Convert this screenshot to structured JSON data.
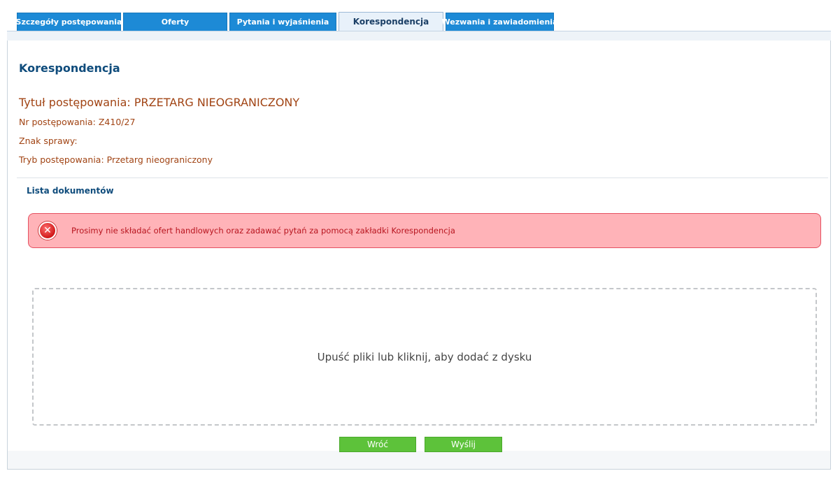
{
  "tabs": [
    {
      "label": "Szczegóły postępowania",
      "active": false
    },
    {
      "label": "Oferty",
      "active": false
    },
    {
      "label": "Pytania i wyjaśnienia",
      "active": false
    },
    {
      "label": "Korespondencja",
      "active": true
    },
    {
      "label": "Wezwania i zawiadomienia",
      "active": false
    }
  ],
  "page": {
    "section_title": "Korespondencja",
    "procedure_title": "Tytuł postępowania: PRZETARG NIEOGRANICZONY",
    "procedure_number": "Nr postępowania: Z410/27",
    "case_sign": "Znak sprawy:",
    "procedure_mode": "Tryb postępowania: Przetarg nieograniczony",
    "document_list_label": "Lista dokumentów"
  },
  "alert": {
    "icon": "error-x-icon",
    "message": "Prosimy nie składać ofert handlowych oraz zadawać pytań za pomocą zakładki Korespondencja",
    "color_bg": "#ffb3b8",
    "color_border": "#e55060",
    "color_text": "#b8141e"
  },
  "dropzone": {
    "text": "Upuść pliki lub kliknij, aby dodać z dysku"
  },
  "buttons": {
    "back_label": "Wróć",
    "send_label": "Wyślij"
  },
  "colors": {
    "tab_bg": "#1d8ad6",
    "tab_active_bg": "#e8f1fa",
    "heading": "#0f4c7c",
    "meta_text": "#a14414",
    "button_green": "#5dc23a"
  }
}
